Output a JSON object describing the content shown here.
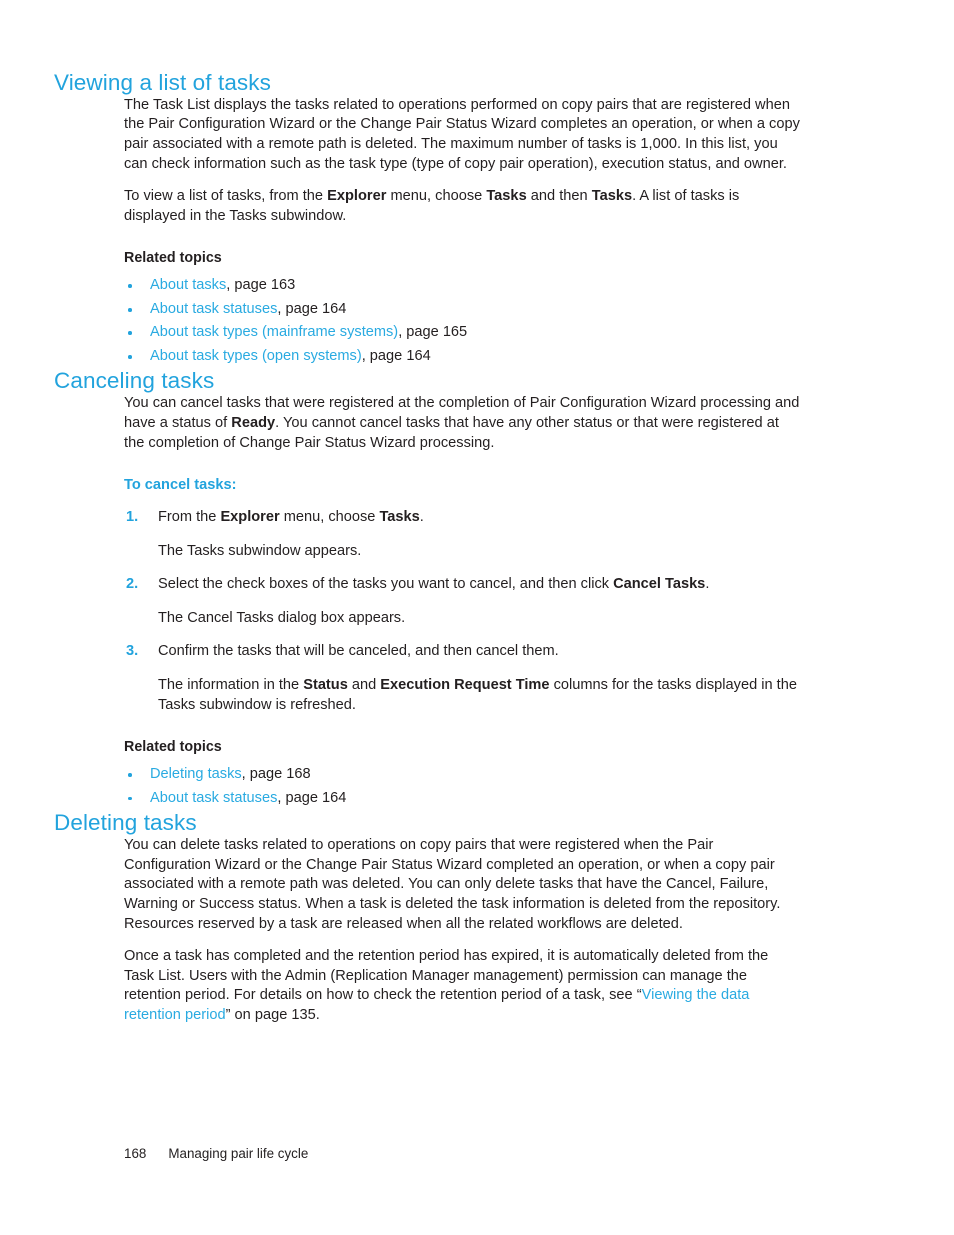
{
  "colors": {
    "heading_blue": "#22a3dd",
    "link_blue": "#29aae1",
    "body_black": "#231f20"
  },
  "sections": {
    "viewing": {
      "heading": "Viewing a list of tasks",
      "para1": "The Task List displays the tasks related to operations performed on copy pairs that are registered when the Pair Configuration Wizard or the Change Pair Status Wizard completes an operation, or when a copy pair associated with a remote path is deleted. The maximum number of tasks is 1,000.  In this list, you can check information such as the task type (type of copy pair operation), execution status, and owner.",
      "para2": {
        "t1": "To view a list of tasks, from the ",
        "b1": "Explorer",
        "t2": " menu, choose ",
        "b2": "Tasks",
        "t3": " and then ",
        "b3": "Tasks",
        "t4": ". A list of tasks is displayed in the Tasks subwindow."
      },
      "related_heading": "Related topics",
      "related": [
        {
          "link": "About tasks",
          "suffix": ", page 163"
        },
        {
          "link": "About task statuses",
          "suffix": ", page 164"
        },
        {
          "link": "About task types (mainframe systems)",
          "suffix": ", page 165"
        },
        {
          "link": "About task types (open systems)",
          "suffix": ", page 164"
        }
      ]
    },
    "canceling": {
      "heading": "Canceling tasks",
      "para1": {
        "t1": "You can cancel tasks that were registered at the completion of Pair Configuration Wizard processing and have a status of ",
        "b1": "Ready",
        "t2": ". You cannot cancel tasks that have any other status or that were registered at the completion of Change Pair Status Wizard processing."
      },
      "proc_heading": "To cancel tasks:",
      "steps": [
        {
          "num": "1.",
          "t1": "From the ",
          "b1": "Explorer",
          "t2": " menu, choose ",
          "b2": "Tasks",
          "t3": ".",
          "result": "The Tasks subwindow appears."
        },
        {
          "num": "2.",
          "t1": "Select the check boxes of the tasks you want to cancel, and then click ",
          "b1": "Cancel Tasks",
          "t2": "",
          "b2": "",
          "t3": ".",
          "result": "The Cancel Tasks dialog box appears."
        },
        {
          "num": "3.",
          "t1": "Confirm the tasks that will be canceled, and then cancel them.",
          "b1": "",
          "t2": "",
          "b2": "",
          "t3": "",
          "result_rich": {
            "t1": "The information in the ",
            "b1": "Status",
            "t2": " and ",
            "b2": "Execution Request Time",
            "t3": " columns for the tasks displayed in the Tasks subwindow is refreshed."
          }
        }
      ],
      "related_heading": "Related topics",
      "related": [
        {
          "link": "Deleting tasks",
          "suffix": ", page 168"
        },
        {
          "link": "About task statuses",
          "suffix": ", page 164"
        }
      ]
    },
    "deleting": {
      "heading": "Deleting tasks",
      "para1": "You can delete tasks related to operations on copy pairs that were registered when the Pair Configuration Wizard or the Change Pair Status Wizard completed an operation, or when a copy pair associated with a remote path was deleted. You can only delete tasks that have the Cancel, Failure, Warning or Success status. When a task is deleted the task information is deleted from the repository. Resources reserved by a task are released when all the related workflows are deleted.",
      "para2": {
        "t1": "Once a task has completed and the retention period has expired, it is automatically deleted from the Task List. Users with the Admin (Replication Manager management) permission can manage the retention period. For details on how to check the retention period of a task, see “",
        "link": "Viewing the data retention period",
        "t2": "” on page 135."
      }
    }
  },
  "footer": {
    "page_number": "168",
    "chapter": "Managing pair life cycle"
  }
}
